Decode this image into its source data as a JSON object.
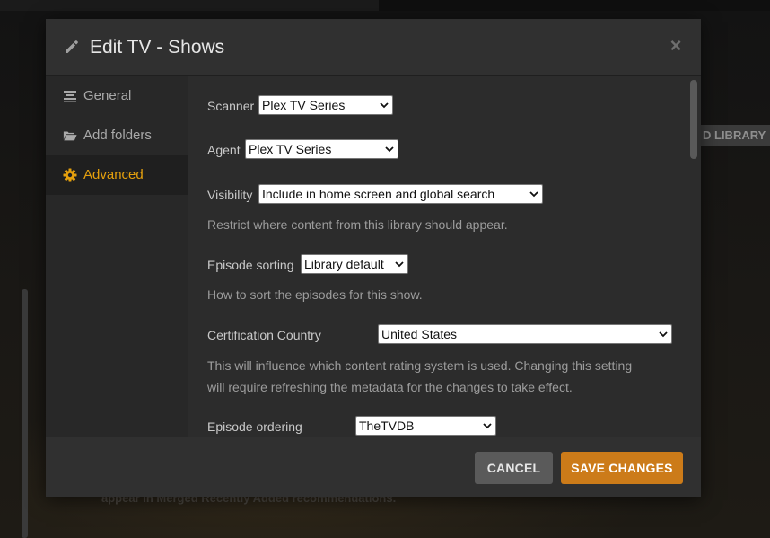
{
  "background": {
    "library_button_label": "D LIBRARY",
    "footer_text": "appear in Merged Recently Added recommendations."
  },
  "modal": {
    "title": "Edit TV - Shows",
    "header_icon": "pencil-icon",
    "close_icon": "close-icon",
    "close_glyph": "×"
  },
  "sidebar": {
    "items": [
      {
        "label": "General",
        "icon": "list-icon",
        "active": false
      },
      {
        "label": "Add folders",
        "icon": "folder-open-icon",
        "active": false
      },
      {
        "label": "Advanced",
        "icon": "gear-icon",
        "active": true
      }
    ]
  },
  "settings": {
    "scanner": {
      "label": "Scanner",
      "value": "Plex TV Series"
    },
    "agent": {
      "label": "Agent",
      "value": "Plex TV Series"
    },
    "visibility": {
      "label": "Visibility",
      "value": "Include in home screen and global search",
      "help": "Restrict where content from this library should appear."
    },
    "episode_sorting": {
      "label": "Episode sorting",
      "value": "Library default",
      "help": "How to sort the episodes for this show."
    },
    "certification_country": {
      "label": "Certification Country",
      "value": "United States",
      "help_line1": "This will influence which content rating system is used. Changing this setting",
      "help_line2": "will require refreshing the metadata for the changes to take effect."
    },
    "episode_ordering": {
      "label": "Episode ordering",
      "value": "TheTVDB"
    }
  },
  "footer": {
    "cancel_label": "CANCEL",
    "save_label": "SAVE CHANGES"
  },
  "colors": {
    "accent": "#e5a00d",
    "save_button": "#cc7b19",
    "cancel_button": "#5a5a5a"
  }
}
